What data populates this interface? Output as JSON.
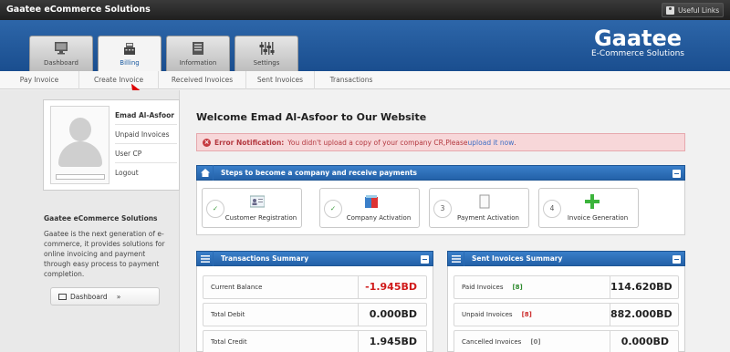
{
  "topbar": {
    "brand": "Gaatee eCommerce Solutions",
    "useful_links": "Useful Links",
    "useful_icon": "user-icon"
  },
  "logo": {
    "main": "Gaatee",
    "sub": "E-Commerce Solutions"
  },
  "tabs": [
    {
      "label": "Dashboard",
      "icon": "monitor-icon",
      "active": false
    },
    {
      "label": "Billing",
      "icon": "cash-register-icon",
      "active": true
    },
    {
      "label": "Information",
      "icon": "document-icon",
      "active": false
    },
    {
      "label": "Settings",
      "icon": "sliders-icon",
      "active": false
    }
  ],
  "subnav": [
    "Pay Invoice",
    "Create Invoice",
    "Received Invoices",
    "Sent Invoices",
    "Transactions"
  ],
  "profile": {
    "name": "Emad Al-Asfoor",
    "menu": [
      "Unpaid Invoices",
      "User CP",
      "Logout"
    ]
  },
  "about": {
    "title": "Gaatee eCommerce Solutions",
    "text": "Gaatee is the next generation of e-commerce, it provides solutions for online invoicing and payment through easy process to payment completion."
  },
  "sidebar_button": {
    "label": "Dashboard",
    "icon": "monitor-icon",
    "arrow": "»"
  },
  "welcome": "Welcome Emad Al-Asfoor to Our Website",
  "error": {
    "title": "Error Notification:",
    "message": " You didn't upload a copy of your company CR,Please ",
    "link": "upload it now",
    "end": "."
  },
  "steps": {
    "title": "Steps to become a company and receive payments",
    "items": [
      {
        "num": "✓",
        "done": true,
        "label": "Customer Registration",
        "icon": "id-card-icon"
      },
      {
        "num": "✓",
        "done": true,
        "label": "Company Activation",
        "icon": "shield-icon"
      },
      {
        "num": "3",
        "done": false,
        "label": "Payment Activation",
        "icon": "blank-page-icon"
      },
      {
        "num": "4",
        "done": false,
        "label": "Invoice Generation",
        "icon": "plus-icon"
      }
    ]
  },
  "transactions": {
    "title": "Transactions Summary",
    "rows": [
      {
        "label": "Current Balance",
        "value": "-1.945BD",
        "negative": true
      },
      {
        "label": "Total Debit",
        "value": "0.000BD",
        "negative": false
      },
      {
        "label": "Total Credit",
        "value": "1.945BD",
        "negative": false
      }
    ]
  },
  "sent": {
    "title": "Sent Invoices Summary",
    "rows": [
      {
        "label": "Paid Invoices",
        "count": "[8]",
        "color": "green",
        "value": "114.620BD"
      },
      {
        "label": "Unpaid Invoices",
        "count": "[8]",
        "color": "red",
        "value": "882.000BD"
      },
      {
        "label": "Cancelled Invoices",
        "count": "[0]",
        "color": "gray",
        "value": "0.000BD"
      }
    ]
  }
}
